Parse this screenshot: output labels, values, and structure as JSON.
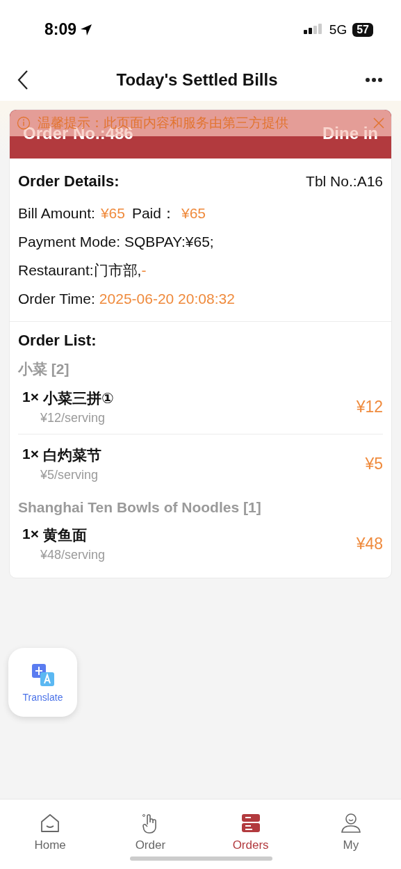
{
  "status_bar": {
    "time": "8:09",
    "network": "5G",
    "battery": "57"
  },
  "nav": {
    "title": "Today's Settled Bills"
  },
  "notice": {
    "text": "温馨提示：此页面内容和服务由第三方提供"
  },
  "order": {
    "number": "Order No.:486",
    "service": "Dine in"
  },
  "details": {
    "heading": "Order Details:",
    "table": "Tbl No.:A16",
    "bill_label": "Bill Amount:",
    "bill": "¥65",
    "paid_label": "Paid：",
    "paid": "¥65",
    "payment": "Payment Mode: SQBPAY:¥65;",
    "restaurant": "Restaurant:门市部,",
    "restaurant_suffix": "-",
    "time_label": "Order Time:",
    "time": "2025-06-20 20:08:32"
  },
  "order_list": {
    "heading": "Order List:",
    "groups": [
      {
        "name": "小菜 [2]",
        "items": [
          {
            "qty": "1×",
            "name": "小菜三拼①",
            "unit": "¥12/serving",
            "total": "¥12"
          },
          {
            "qty": "1×",
            "name": "白灼菜节",
            "unit": "¥5/serving",
            "total": "¥5"
          }
        ]
      },
      {
        "name": "Shanghai Ten Bowls of Noodles [1]",
        "items": [
          {
            "qty": "1×",
            "name": "黄鱼面",
            "unit": "¥48/serving",
            "total": "¥48"
          }
        ]
      }
    ]
  },
  "translate": {
    "label": "Translate"
  },
  "tabs": [
    {
      "kind": "home",
      "label": "Home",
      "selected": false
    },
    {
      "kind": "order",
      "label": "Order",
      "selected": false
    },
    {
      "kind": "orders",
      "label": "Orders",
      "selected": true
    },
    {
      "kind": "my",
      "label": "My",
      "selected": false
    }
  ]
}
